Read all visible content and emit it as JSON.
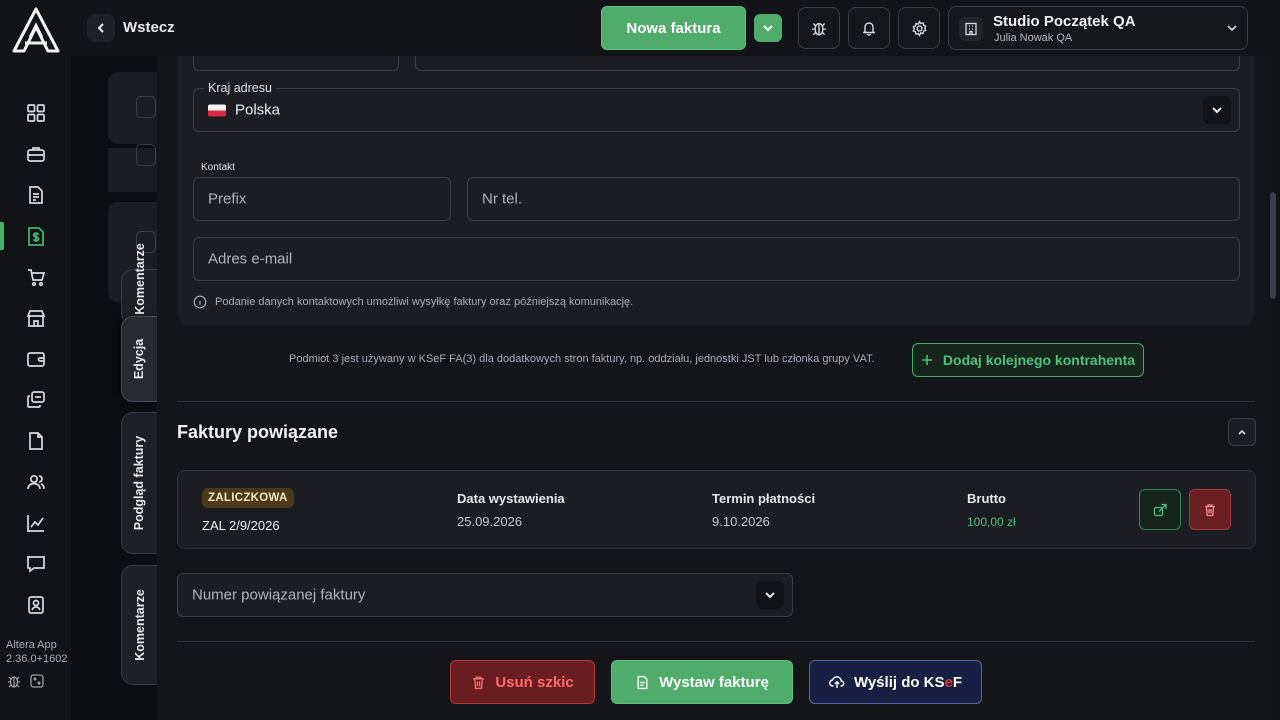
{
  "sidebar": {
    "items": [
      {
        "icon": "grid-icon"
      },
      {
        "icon": "briefcase-icon"
      },
      {
        "icon": "invoice-icon"
      },
      {
        "icon": "dollar-document-icon",
        "active": true
      },
      {
        "icon": "cart-icon"
      },
      {
        "icon": "store-icon"
      },
      {
        "icon": "wallet-icon"
      },
      {
        "icon": "cards-icon"
      },
      {
        "icon": "file-icon"
      },
      {
        "icon": "users-icon"
      },
      {
        "icon": "chart-icon"
      },
      {
        "icon": "chat-icon"
      },
      {
        "icon": "contact-icon"
      }
    ],
    "app_name": "Altera App",
    "app_version": "2.36.0+1602"
  },
  "side_tabs": {
    "partial": "Komentarze",
    "edit": "Edycja",
    "preview": "Podgląd faktury",
    "comments": "Komentarze"
  },
  "topbar": {
    "back_label": "Wstecz",
    "new_invoice": "Nowa faktura",
    "company_name": "Studio Początek QA",
    "company_user": "Julia Nowak QA"
  },
  "form": {
    "country_label": "Kraj adresu",
    "country_value": "Polska",
    "contact_section": "Kontakt",
    "prefix_placeholder": "Prefix",
    "phone_placeholder": "Nr tel.",
    "email_placeholder": "Adres e-mail",
    "contact_hint": "Podanie danych kontaktowych umożliwi wysyłkę faktury oraz późniejszą komunikację."
  },
  "subject3": {
    "info": "Podmiot 3 jest używany w KSeF FA(3) dla dodatkowych stron faktury, np. oddziału, jednostki JST lub członka grupy VAT.",
    "add_button": "Dodaj kolejnego kontrahenta"
  },
  "related": {
    "title": "Faktury powiązane",
    "invoice": {
      "badge": "ZALICZKOWA",
      "number": "ZAL 2/9/2026",
      "issue_date_label": "Data wystawienia",
      "issue_date": "25.09.2026",
      "due_date_label": "Termin płatności",
      "due_date": "9.10.2026",
      "gross_label": "Brutto",
      "gross": "100,00 zł"
    },
    "number_placeholder": "Numer powiązanej faktury"
  },
  "actions": {
    "delete_draft": "Usuń szkic",
    "issue_invoice": "Wystaw fakturę",
    "send_ksef_prefix": "Wyślij do KS",
    "send_ksef_e": "e",
    "send_ksef_suffix": "F"
  },
  "colors": {
    "accent_green": "#4fac6b",
    "danger": "#6a1d21",
    "ksef_navy": "#172043",
    "badge_advance": "#4a3a17"
  }
}
